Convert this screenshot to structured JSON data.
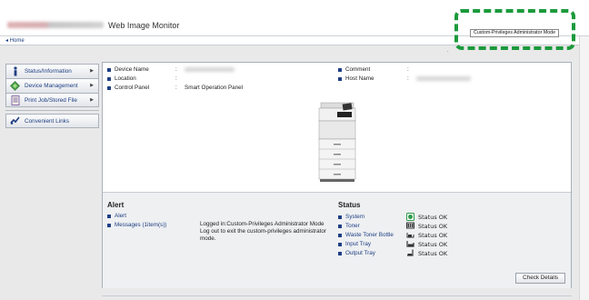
{
  "header": {
    "app_title": "Web Image Monitor",
    "home_link": "◂ Home",
    "mode_badge": "Custom-Privileges Administrator Mode"
  },
  "left_nav": {
    "groups": [
      {
        "items": [
          {
            "label": "Status/Information",
            "icon": "info-icon"
          },
          {
            "label": "Device Management",
            "icon": "device-management-icon"
          },
          {
            "label": "Print Job/Stored File",
            "icon": "document-icon"
          }
        ]
      },
      {
        "items": [
          {
            "label": "Convenient Links",
            "icon": "link-icon"
          }
        ]
      }
    ]
  },
  "device_info": {
    "device_name_label": "Device Name",
    "location_label": "Location",
    "location_value": "",
    "control_panel_label": "Control Panel",
    "control_panel_value": "Smart Operation Panel",
    "comment_label": "Comment",
    "host_name_label": "Host Name",
    "colon": ":"
  },
  "alert": {
    "title": "Alert",
    "alert_link": "Alert",
    "messages_link": "Messages (1item(s))",
    "message_text": "Logged in:Custom-Privileges Administrator Mode Log out to exit the custom-privileges administrator mode."
  },
  "status": {
    "title": "Status",
    "rows": [
      {
        "label": "System",
        "value": "Status OK",
        "icon": "system-status-icon",
        "color": "#2e9a4a"
      },
      {
        "label": "Toner",
        "value": "Status OK",
        "icon": "toner-icon",
        "color": "#333333"
      },
      {
        "label": "Waste Toner Bottle",
        "value": "Status OK",
        "icon": "waste-toner-icon",
        "color": "#333333"
      },
      {
        "label": "Input Tray",
        "value": "Status OK",
        "icon": "input-tray-icon",
        "color": "#333333"
      },
      {
        "label": "Output Tray",
        "value": "Status OK",
        "icon": "output-tray-icon",
        "color": "#333333"
      }
    ]
  },
  "check_details_button": "Check Details",
  "colors": {
    "accent": "#1f3f83",
    "highlight_box": "#1c9a3c",
    "panel_bg": "#eef0f2"
  }
}
